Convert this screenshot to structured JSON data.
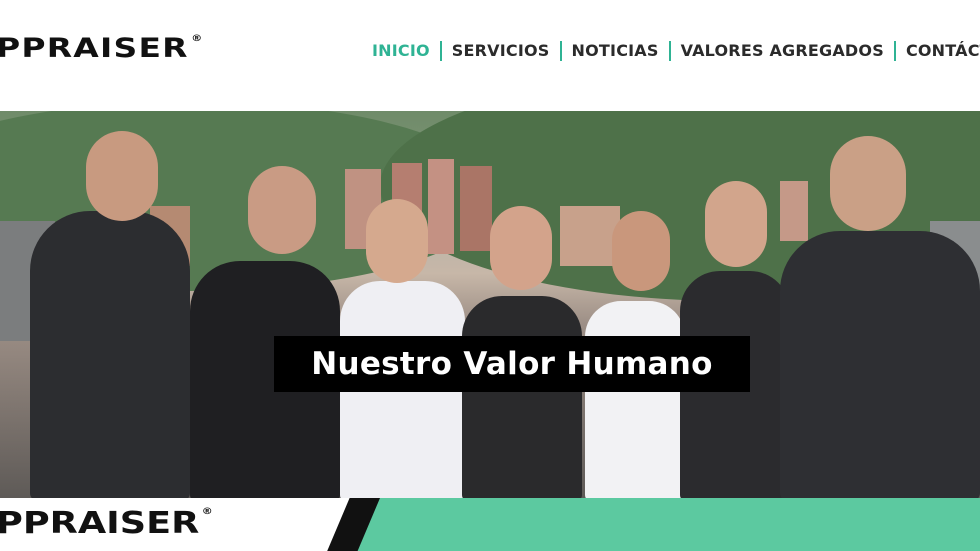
{
  "brand": {
    "name": "PPRAISER",
    "mark": "®"
  },
  "nav": {
    "items": [
      "INICIO",
      "SERVICIOS",
      "NOTICIAS",
      "VALORES AGREGADOS",
      "CONTÁCTE"
    ],
    "active": "INICIO"
  },
  "hero": {
    "caption": "Nuestro Valor Humano"
  },
  "footer_band": {
    "brand": "PPRAISER",
    "mark": "®"
  },
  "colors": {
    "accent": "#2fb394",
    "band": "#5cc9a0",
    "caption_bg": "#000000"
  }
}
